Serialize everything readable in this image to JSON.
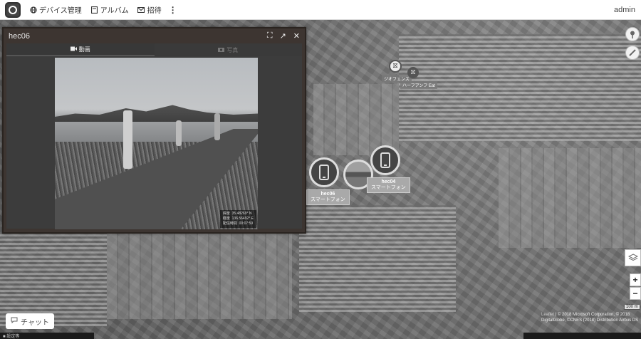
{
  "topbar": {
    "nav": [
      {
        "icon": "device-icon",
        "label": "デバイス管理"
      },
      {
        "icon": "album-icon",
        "label": "アルバム"
      },
      {
        "icon": "mail-icon",
        "label": "招待"
      }
    ],
    "more_icon": "kebab-icon",
    "user": "admin"
  },
  "panel": {
    "title": "hec06",
    "tools": {
      "fullscreen": "⛶",
      "popout": "↗",
      "close": "✕"
    },
    "tabs": [
      {
        "label": "動画",
        "active": true
      },
      {
        "label": "写真",
        "active": false
      }
    ],
    "coords": "緯度  35.48269° N\n経度  136.56492° E\n配信時間  00:07:59"
  },
  "markers": [
    {
      "name": "hec06",
      "type": "スマートフォン"
    },
    {
      "name": "hec04",
      "type": "スマートフォン"
    }
  ],
  "fences": [
    {
      "label": "ジオフェンス"
    },
    {
      "label": "ハーフアンフ\nEat"
    }
  ],
  "map": {
    "scale": "100 m",
    "attribution_leaflet": "Leaflet",
    "attribution": "| © 2018 Microsoft Corporation, © 2018 DigitalGlobe, ©CNES (2018) Distribution Airbus DS"
  },
  "chat": {
    "label": "チャット"
  },
  "status": {
    "left": "■ 設定等"
  },
  "colors": {
    "panel_bg": "#3d3531",
    "topbar_bg": "#ffffff",
    "tag_bg": "#a9a9a9"
  }
}
